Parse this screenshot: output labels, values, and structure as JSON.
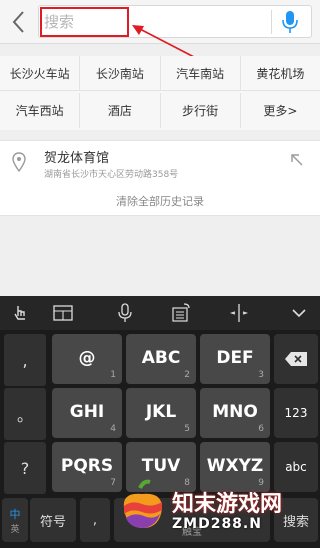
{
  "search": {
    "placeholder": "搜索"
  },
  "quick_locations": {
    "row1": [
      "长沙火车站",
      "长沙南站",
      "汽车南站",
      "黄花机场"
    ],
    "row2": [
      "汽车西站",
      "酒店",
      "步行街",
      "更多>"
    ]
  },
  "history": {
    "items": [
      {
        "title": "贺龙体育馆",
        "address": "湖南省长沙市天心区劳动路358号"
      }
    ],
    "clear_label": "清除全部历史记录"
  },
  "keyboard": {
    "side_keys": [
      ",",
      "。",
      "?",
      "..."
    ],
    "keys": [
      {
        "main": "@",
        "num": "1"
      },
      {
        "main": "ABC",
        "num": "2"
      },
      {
        "main": "DEF",
        "num": "3"
      },
      {
        "main": "GHI",
        "num": "4"
      },
      {
        "main": "JKL",
        "num": "5"
      },
      {
        "main": "MNO",
        "num": "6"
      },
      {
        "main": "PQRS",
        "num": "7"
      },
      {
        "main": "TUV",
        "num": "8"
      },
      {
        "main": "WXYZ",
        "num": "9"
      }
    ],
    "right_keys": {
      "r2": "123",
      "r3": "abc"
    },
    "bottom": {
      "lang_primary": "中",
      "lang_secondary": "英",
      "symbols": "符号",
      "comma": ",",
      "space_hint": "触宝",
      "search": "搜索"
    }
  },
  "watermark": {
    "title": "知末游戏网",
    "subtitle": "ZMD288.N"
  },
  "colors": {
    "accent_red": "#e01b24",
    "mic_blue": "#2196f3",
    "keyboard_bg": "#1b1b1b",
    "key_bg": "#484848"
  }
}
